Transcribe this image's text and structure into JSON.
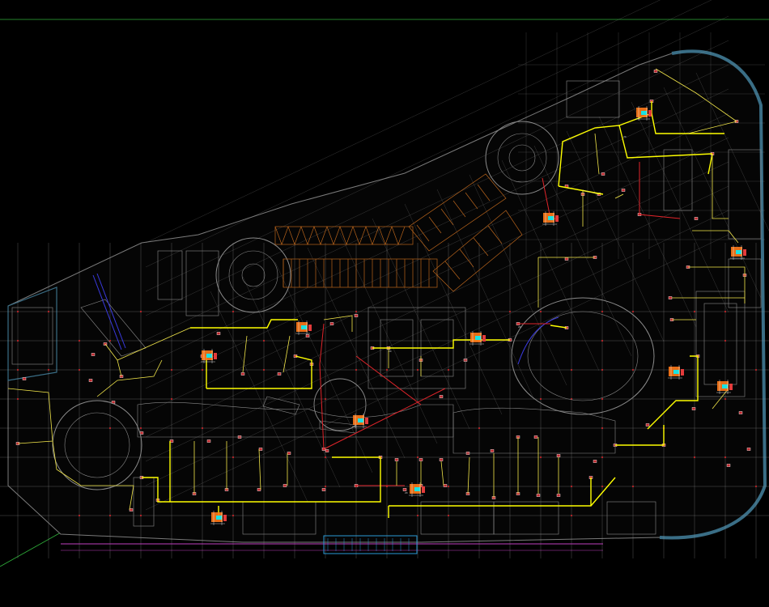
{
  "drawing": {
    "background": "#000000",
    "colors": {
      "grid": "#9a9a9a",
      "axis_marker": "#c0262b",
      "wall": "#8a8a8a",
      "feeder": "#ffff00",
      "feeder_alt": "#f2e64a",
      "red_line": "#e0242a",
      "parking_ramp": "#b8641c",
      "panel": "#ff7a1a",
      "panel_cyan": "#19e3e3",
      "outline_teal": "#3a6e86",
      "frame_green": "#2fae3a",
      "facade_magenta": "#c040c0",
      "facade_cyan": "#2a9ad8",
      "blue_line": "#3a3adf"
    },
    "icons": [
      "electrical-panel-icon",
      "column-marker-icon"
    ]
  }
}
